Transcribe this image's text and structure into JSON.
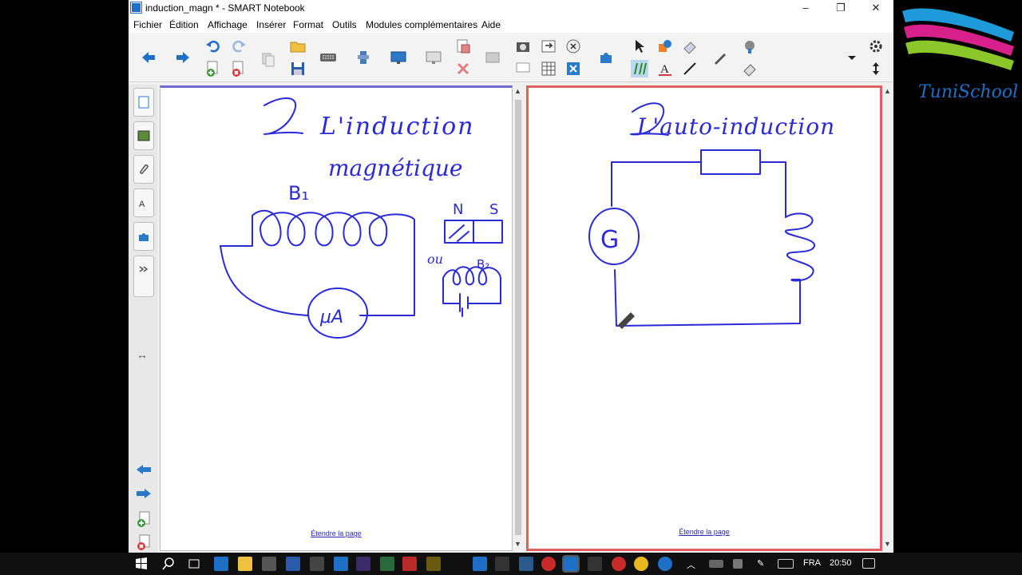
{
  "window": {
    "title": "induction_magn * - SMART Notebook",
    "minimize": "–",
    "restore": "❐",
    "close": "✕"
  },
  "menu": [
    "Fichier",
    "Édition",
    "Affichage",
    "Insérer",
    "Format",
    "Outils",
    "Modules complémentaires",
    "Aide"
  ],
  "toolbar_icons": [
    "back-arrow-icon",
    "forward-arrow-icon",
    "undo-icon",
    "redo-icon",
    "add-page-icon",
    "delete-page-icon",
    "paste-icon",
    "open-icon",
    "save-icon",
    "keyboard-icon",
    "tools-icon",
    "screen-shade-icon",
    "display-icon",
    "capture-icon",
    "delete-icon",
    "table-icon",
    "math-icon",
    "addon-icon",
    "select-icon",
    "shapes-icon",
    "eraser-icon",
    "pen-icon",
    "text-icon",
    "line-icon",
    "magic-pen-icon",
    "fill-icon",
    "settings-icon"
  ],
  "sidebar_tabs": [
    "page-sorter-icon",
    "gallery-icon",
    "attachments-icon",
    "properties-icon",
    "addons-icon"
  ],
  "pages": [
    {
      "title_line1": "L'induction",
      "title_line2": "magnétique",
      "label_b1": "B₁",
      "label_n": "N",
      "label_s": "S",
      "label_ou": "ou",
      "label_b2": "B₂",
      "meter_label": "μA",
      "link": "Étendre la page"
    },
    {
      "title": "L'auto-induction",
      "galvanometer_label": "G",
      "link": "Étendre la page"
    }
  ],
  "logo_text": "TuniSchool",
  "taskbar": {
    "lang": "FRA",
    "time": "20:50"
  },
  "colors": {
    "ink": "#2a2ad8",
    "accent_blue": "#1e6fc6",
    "page_border_selected": "#e06060"
  }
}
